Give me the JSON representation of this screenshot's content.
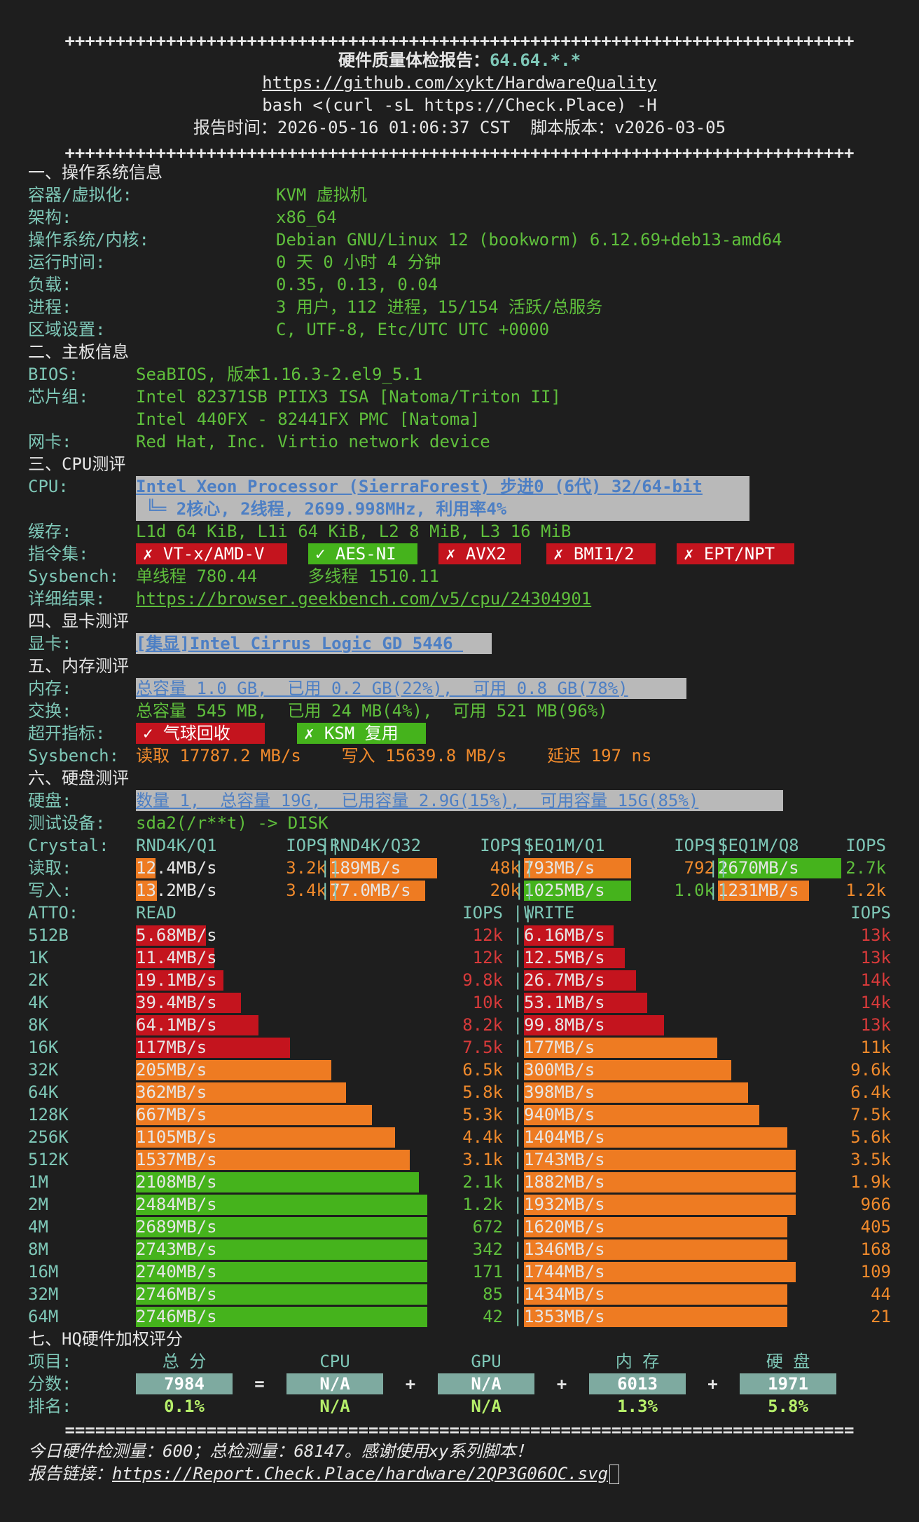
{
  "header": {
    "border_top": "++++++++++++++++++++++++++++++++++++++++++++++++++++++++++++++++++++++++++++++",
    "title_label": "硬件质量体检报告：",
    "title_ip": "64.64.*.*",
    "repo_url": "https://github.com/xykt/HardwareQuality",
    "command": "bash <(curl -sL https://Check.Place) -H",
    "time_line": "报告时间：2026-05-16 01:06:37 CST  脚本版本：v2026-03-05",
    "border_bottom": "++++++++++++++++++++++++++++++++++++++++++++++++++++++++++++++++++++++++++++++"
  },
  "sec1": {
    "title": "一、操作系统信息",
    "rows": [
      {
        "k": "容器/虚拟化:",
        "v": "KVM 虚拟机"
      },
      {
        "k": "架构:",
        "v": "x86_64"
      },
      {
        "k": "操作系统/内核:",
        "v": "Debian GNU/Linux 12 (bookworm) 6.12.69+deb13-amd64"
      },
      {
        "k": "运行时间:",
        "v": "0 天 0 小时 4 分钟"
      },
      {
        "k": "负载:",
        "v": "0.35, 0.13, 0.04"
      },
      {
        "k": "进程:",
        "v": "3 用户，112 进程，15/154 活跃/总服务"
      },
      {
        "k": "区域设置:",
        "v": "C, UTF-8, Etc/UTC UTC +0000"
      }
    ]
  },
  "sec2": {
    "title": "二、主板信息",
    "bios_k": "BIOS:",
    "bios_v": "SeaBIOS, 版本1.16.3-2.el9_5.1",
    "chip_k": "芯片组:",
    "chip_v1": "Intel 82371SB PIIX3 ISA [Natoma/Triton II]",
    "chip_v2": "Intel 440FX - 82441FX PMC [Natoma]",
    "nic_k": "网卡:",
    "nic_v": "Red Hat, Inc. Virtio network device"
  },
  "sec3": {
    "title": "三、CPU测评",
    "cpu_k": "CPU:",
    "cpu_v1": "Intel Xeon Processor (SierraForest) 步进0 (6代) 32/64-bit",
    "cpu_v2": " ╚═ 2核心, 2线程, 2699.998MHz, 利用率4%",
    "cpu_usage_pct": 4,
    "cache_k": "缓存:",
    "cache_v": "L1d 64 KiB, L1i 64 KiB, L2 8 MiB, L3 16 MiB",
    "isa_k": "指令集:",
    "isa": [
      {
        "label": "✗ VT-x/AMD-V",
        "color": "#c4141e"
      },
      {
        "label": "✓ AES-NI",
        "color": "#45b31c"
      },
      {
        "label": "✗ AVX2",
        "color": "#c4141e"
      },
      {
        "label": "✗ BMI1/2",
        "color": "#c4141e"
      },
      {
        "label": "✗ EPT/NPT",
        "color": "#c4141e"
      }
    ],
    "sysbench_k": "Sysbench:",
    "sysbench_v": "单线程 780.44     多线程 1510.11",
    "detail_k": "详细结果:",
    "detail_v": "https://browser.geekbench.com/v5/cpu/24304901"
  },
  "sec4": {
    "title": "四、显卡测评",
    "gpu_k": "显卡:",
    "gpu_v": "[集显]Intel Cirrus Logic GD 5446 "
  },
  "sec5": {
    "title": "五、内存测评",
    "mem_k": "内存:",
    "mem_v": "总容量 1.0 GB,  已用 0.2 GB(22%),  可用 0.8 GB(78%)",
    "mem_used_pct": 22,
    "swap_k": "交换:",
    "swap_v": "总容量 545 MB,  已用 24 MB(4%),  可用 521 MB(96%)",
    "swap_used_pct": 4,
    "over_k": "超开指标:",
    "over": [
      {
        "label": "✓ 气球回收",
        "color": "#c4141e"
      },
      {
        "label": "✗ KSM 复用",
        "color": "#45b31c"
      }
    ],
    "sb_k": "Sysbench:",
    "sb_v": "读取 17787.2 MB/s    写入 15639.8 MB/s    延迟 197 ns"
  },
  "sec6": {
    "title": "六、硬盘测评",
    "disk_k": "硬盘:",
    "disk_v": "数量 1,  总容量 19G,  已用容量 2.9G(15%),  可用容量 15G(85%)",
    "disk_used_pct": 15,
    "dev_k": "测试设备:",
    "dev_v": "sda2(/r**t) -> DISK",
    "crystal": {
      "label": "Crystal:",
      "cols": [
        "RND4K/Q1",
        "IOPS",
        "RND4K/Q32",
        "IOPS",
        "SEQ1M/Q1",
        "IOPS",
        "SEQ1M/Q8",
        "IOPS"
      ],
      "read_label": "读取:",
      "write_label": "写入:",
      "read": [
        {
          "v": "12.4MB/s",
          "iops": "3.2k",
          "color": "#ee7b22",
          "fill": 0.13
        },
        {
          "v": "189MB/s",
          "iops": "48k",
          "color": "#ee7b22",
          "fill": 0.72
        },
        {
          "v": "793MB/s",
          "iops": "792",
          "color": "#ee7b22",
          "fill": 0.72
        },
        {
          "v": "2670MB/s",
          "iops": "2.7k",
          "color": "#45b31c",
          "fill": 0.98
        }
      ],
      "write": [
        {
          "v": "13.2MB/s",
          "iops": "3.4k",
          "color": "#ee7b22",
          "fill": 0.14
        },
        {
          "v": "77.0MB/s",
          "iops": "20k",
          "color": "#ee7b22",
          "fill": 0.64
        },
        {
          "v": "1025MB/s",
          "iops": "1.0k",
          "color": "#45b31c",
          "fill": 0.72
        },
        {
          "v": "1231MB/s",
          "iops": "1.2k",
          "color": "#ee7b22",
          "fill": 0.72
        }
      ]
    },
    "atto": {
      "label": "ATTO:",
      "read_h": "READ",
      "iops_h": "IOPS",
      "write_h": "WRITE",
      "iops_h2": "IOPS",
      "rows": [
        {
          "s": "512B",
          "r": "5.68MB/s",
          "ri": "12k",
          "w": "6.16MB/s",
          "wi": "13k",
          "rc": "red",
          "wc": "red",
          "rf": 0.24,
          "wf": 0.32
        },
        {
          "s": "1K",
          "r": "11.4MB/s",
          "ri": "12k",
          "w": "12.5MB/s",
          "wi": "13k",
          "rc": "red",
          "wc": "red",
          "rf": 0.27,
          "wf": 0.36
        },
        {
          "s": "2K",
          "r": "19.1MB/s",
          "ri": "9.8k",
          "w": "26.7MB/s",
          "wi": "14k",
          "rc": "red",
          "wc": "red",
          "rf": 0.3,
          "wf": 0.4
        },
        {
          "s": "4K",
          "r": "39.4MB/s",
          "ri": "10k",
          "w": "53.1MB/s",
          "wi": "14k",
          "rc": "red",
          "wc": "red",
          "rf": 0.36,
          "wf": 0.44
        },
        {
          "s": "8K",
          "r": "64.1MB/s",
          "ri": "8.2k",
          "w": "99.8MB/s",
          "wi": "13k",
          "rc": "red",
          "wc": "red",
          "rf": 0.42,
          "wf": 0.5
        },
        {
          "s": "16K",
          "r": "117MB/s",
          "ri": "7.5k",
          "w": "177MB/s",
          "wi": "11k",
          "rc": "red",
          "wc": "org",
          "rf": 0.53,
          "wf": 0.69
        },
        {
          "s": "32K",
          "r": "205MB/s",
          "ri": "6.5k",
          "w": "300MB/s",
          "wi": "9.6k",
          "rc": "org",
          "wc": "org",
          "rf": 0.67,
          "wf": 0.74
        },
        {
          "s": "64K",
          "r": "362MB/s",
          "ri": "5.8k",
          "w": "398MB/s",
          "wi": "6.4k",
          "rc": "org",
          "wc": "org",
          "rf": 0.72,
          "wf": 0.8
        },
        {
          "s": "128K",
          "r": "667MB/s",
          "ri": "5.3k",
          "w": "940MB/s",
          "wi": "7.5k",
          "rc": "org",
          "wc": "org",
          "rf": 0.81,
          "wf": 0.84
        },
        {
          "s": "256K",
          "r": "1105MB/s",
          "ri": "4.4k",
          "w": "1404MB/s",
          "wi": "5.6k",
          "rc": "org",
          "wc": "org",
          "rf": 0.89,
          "wf": 0.94
        },
        {
          "s": "512K",
          "r": "1537MB/s",
          "ri": "3.1k",
          "w": "1743MB/s",
          "wi": "3.5k",
          "rc": "org",
          "wc": "org",
          "rf": 0.94,
          "wf": 0.97
        },
        {
          "s": "1M",
          "r": "2108MB/s",
          "ri": "2.1k",
          "w": "1882MB/s",
          "wi": "1.9k",
          "rc": "grn",
          "wc": "org",
          "rf": 0.97,
          "wf": 0.97
        },
        {
          "s": "2M",
          "r": "2484MB/s",
          "ri": "1.2k",
          "w": "1932MB/s",
          "wi": "966",
          "rc": "grn",
          "wc": "org",
          "rf": 1.0,
          "wf": 0.97
        },
        {
          "s": "4M",
          "r": "2689MB/s",
          "ri": "672",
          "w": "1620MB/s",
          "wi": "405",
          "rc": "grn",
          "wc": "org",
          "rf": 1.0,
          "wf": 0.94
        },
        {
          "s": "8M",
          "r": "2743MB/s",
          "ri": "342",
          "w": "1346MB/s",
          "wi": "168",
          "rc": "grn",
          "wc": "org",
          "rf": 1.0,
          "wf": 0.94
        },
        {
          "s": "16M",
          "r": "2740MB/s",
          "ri": "171",
          "w": "1744MB/s",
          "wi": "109",
          "rc": "grn",
          "wc": "org",
          "rf": 1.0,
          "wf": 0.97
        },
        {
          "s": "32M",
          "r": "2746MB/s",
          "ri": "85",
          "w": "1434MB/s",
          "wi": "44",
          "rc": "grn",
          "wc": "org",
          "rf": 1.0,
          "wf": 0.94
        },
        {
          "s": "64M",
          "r": "2746MB/s",
          "ri": "42",
          "w": "1353MB/s",
          "wi": "21",
          "rc": "grn",
          "wc": "org",
          "rf": 1.0,
          "wf": 0.94
        }
      ]
    }
  },
  "sec7": {
    "title": "七、HQ硬件加权评分",
    "item_k": "项目:",
    "heads": [
      "总 分",
      "CPU",
      "GPU",
      "内 存",
      "硬 盘"
    ],
    "score_k": "分数:",
    "scores": [
      "7984",
      "N/A",
      "N/A",
      "6013",
      "1971"
    ],
    "ops": [
      "=",
      "+",
      "+",
      "+"
    ],
    "rank_k": "排名:",
    "ranks": [
      "0.1%",
      "N/A",
      "N/A",
      "1.3%",
      "5.8%"
    ]
  },
  "footer": {
    "rule": "==============================================================================",
    "line1": "今日硬件检测量：600；总检测量：68147。感谢使用xy系列脚本！",
    "link_k": "报告链接：",
    "link_v": "https://Report.Check.Place/hardware/2QP3G06OC.svg"
  }
}
